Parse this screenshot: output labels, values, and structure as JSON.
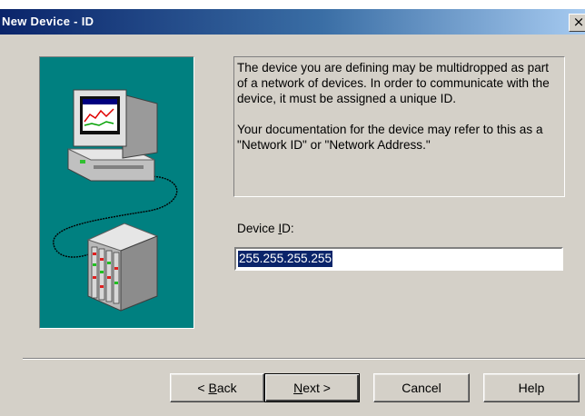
{
  "window": {
    "title": "New Device - ID",
    "close_glyph": "×"
  },
  "illustration": {
    "icon": "computer-connected-to-device-rack",
    "background_color": "#008080"
  },
  "description": {
    "paragraph_1": "The device you are defining may be multidropped as part of a network of devices.  In order to communicate with the device, it must be assigned a unique ID.",
    "paragraph_2": "Your documentation for the device may refer to this as a \"Network ID\" or \"Network Address.\""
  },
  "device_id": {
    "label_pre": "Device ",
    "label_access": "I",
    "label_post": "D:",
    "value": "255.255.255.255"
  },
  "buttons": {
    "back_pre": "< ",
    "back_access": "B",
    "back_post": "ack",
    "next_access": "N",
    "next_post": "ext >",
    "cancel": "Cancel",
    "help": "Help"
  }
}
